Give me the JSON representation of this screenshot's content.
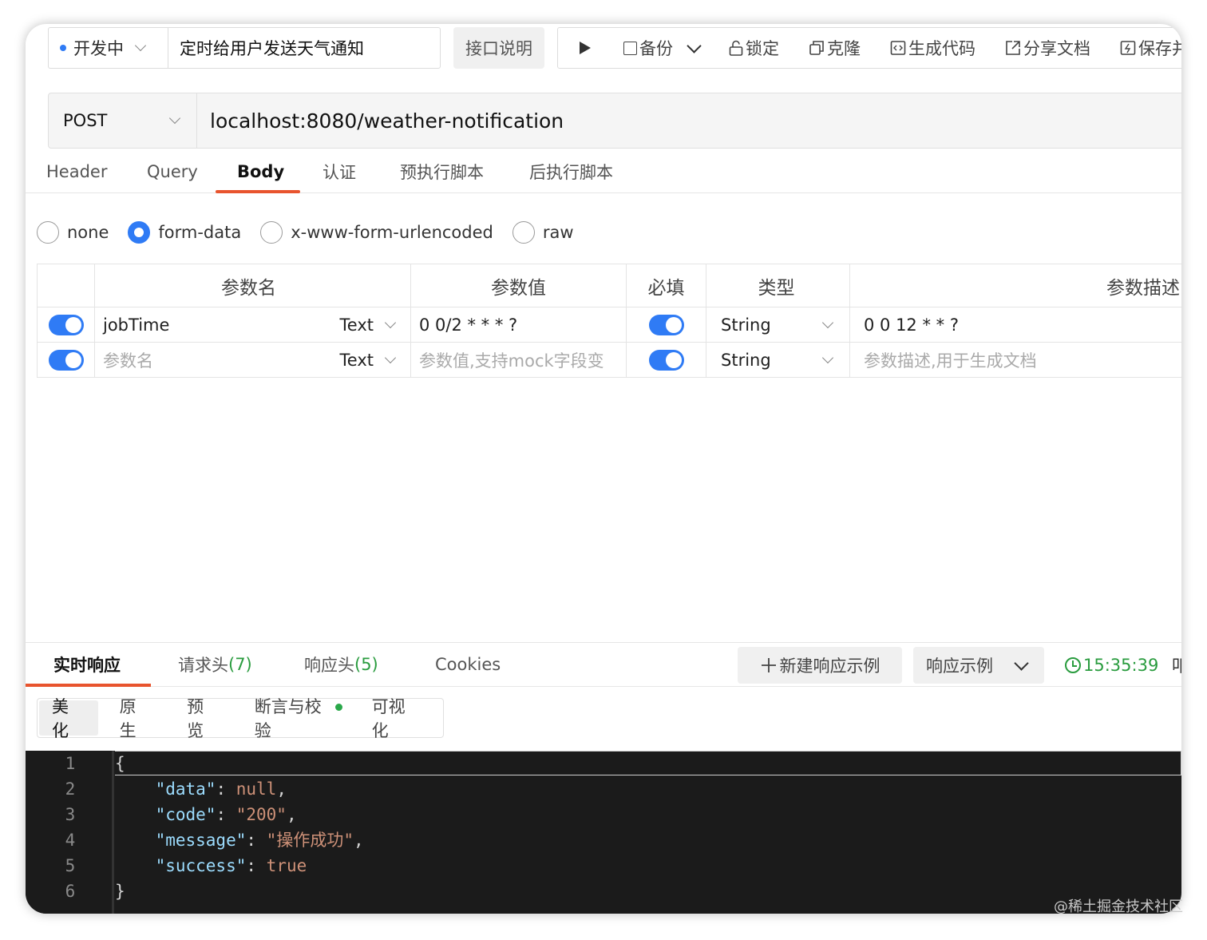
{
  "header": {
    "status_label": "开发中",
    "api_name": "定时给用户发送天气通知",
    "doc_button": "接口说明",
    "toolbar": {
      "backup": "备份",
      "lock": "锁定",
      "clone": "克隆",
      "gen_code": "生成代码",
      "share_doc": "分享文档",
      "save": "保存并"
    }
  },
  "request": {
    "method": "POST",
    "url": "localhost:8080/weather-notification"
  },
  "tabs": [
    "Header",
    "Query",
    "Body",
    "认证",
    "预执行脚本",
    "后执行脚本"
  ],
  "active_tab": "Body",
  "body_types": [
    "none",
    "form-data",
    "x-www-form-urlencoded",
    "raw"
  ],
  "selected_body_type": "form-data",
  "params_table": {
    "columns": [
      "参数名",
      "参数值",
      "必填",
      "类型",
      "参数描述"
    ],
    "rows": [
      {
        "enabled": true,
        "name": "jobTime",
        "name_type": "Text",
        "value": "0 0/2 * * * ?",
        "required": true,
        "type": "String",
        "description": "0 0 12 * * ?"
      },
      {
        "enabled": true,
        "name_placeholder": "参数名",
        "name_type": "Text",
        "value_placeholder": "参数值,支持mock字段变",
        "required": true,
        "type": "String",
        "description_placeholder": "参数描述,用于生成文档"
      }
    ]
  },
  "response": {
    "tabs": {
      "realtime": "实时响应",
      "req_headers": "请求头",
      "req_headers_count": "(7)",
      "resp_headers": "响应头",
      "resp_headers_count": "(5)",
      "cookies": "Cookies"
    },
    "new_example_button": "新建响应示例",
    "example_select": "响应示例",
    "time": "15:35:39",
    "overflow_label": "叩",
    "view_tabs": [
      "美化",
      "原生",
      "预览",
      "断言与校验",
      "可视化"
    ],
    "active_view": "美化",
    "code_lines": [
      {
        "n": "1",
        "text": "{"
      },
      {
        "n": "2",
        "key": "\"data\"",
        "val": "null",
        "tail": ","
      },
      {
        "n": "3",
        "key": "\"code\"",
        "val": "\"200\"",
        "tail": ","
      },
      {
        "n": "4",
        "key": "\"message\"",
        "val": "\"操作成功\"",
        "tail": ","
      },
      {
        "n": "5",
        "key": "\"success\"",
        "val": "true",
        "tail": ""
      },
      {
        "n": "6",
        "text": "}"
      }
    ]
  },
  "watermark": "@稀土掘金技术社区",
  "colors": {
    "accent": "#e8542e",
    "primary": "#2f7bf5",
    "success": "#2a9c3f"
  }
}
